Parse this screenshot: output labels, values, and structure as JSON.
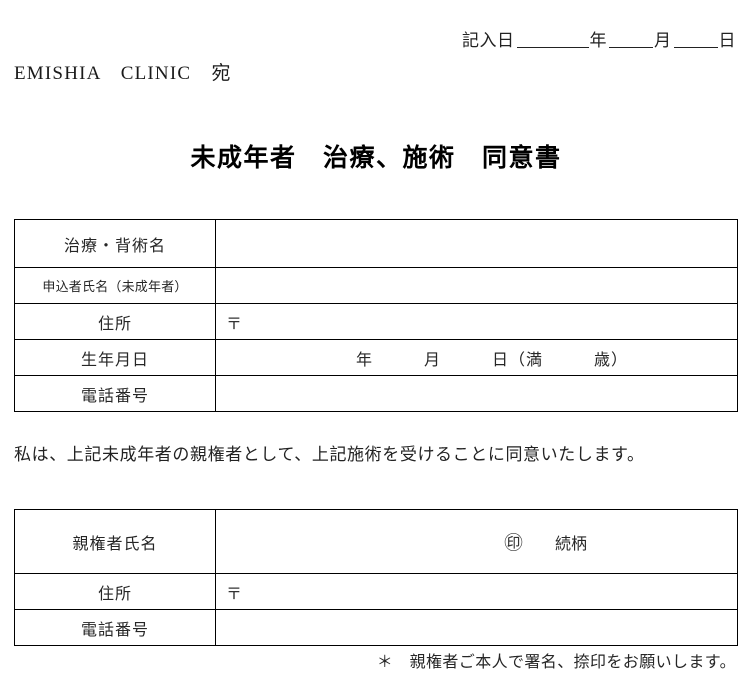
{
  "header": {
    "date_label": "記入日",
    "year_unit": "年",
    "month_unit": "月",
    "day_unit": "日",
    "addressee": "EMISHIA　CLINIC　宛"
  },
  "title": "未成年者　治療、施術　同意書",
  "minor_table": {
    "rows": [
      {
        "label": "治療・背術名",
        "value": ""
      },
      {
        "label": "申込者氏名（未成年者）",
        "value": ""
      },
      {
        "label": "住所",
        "value": "〒"
      },
      {
        "label": "生年月日",
        "value": "年　　　月　　　日（満　　　歳）"
      },
      {
        "label": "電話番号",
        "value": ""
      }
    ]
  },
  "consent_statement": "私は、上記未成年者の親権者として、上記施術を受けることに同意いたします。",
  "guardian_table": {
    "rows": [
      {
        "label": "親権者氏名",
        "seal": "㊞",
        "relation_label": "続柄"
      },
      {
        "label": "住所",
        "value": "〒"
      },
      {
        "label": "電話番号",
        "value": ""
      }
    ]
  },
  "footer_note": "＊　親権者ご本人で署名、捺印をお願いします。"
}
